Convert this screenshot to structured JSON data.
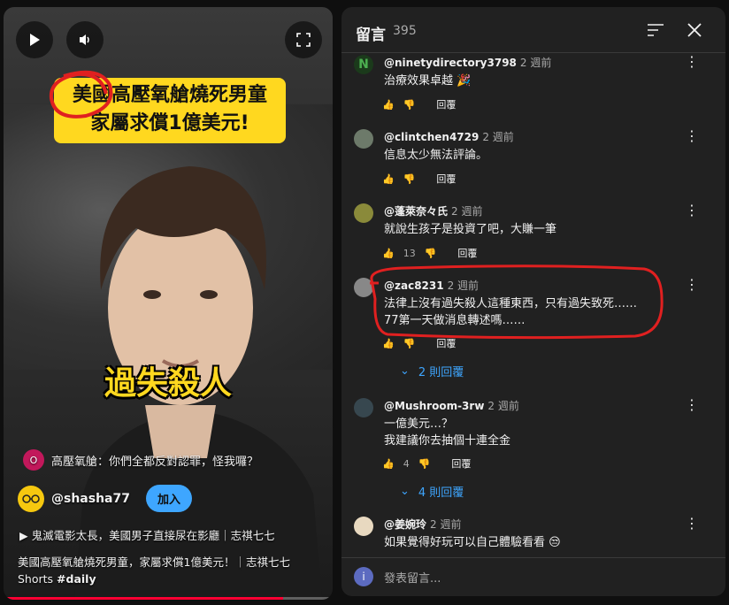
{
  "video": {
    "headline": [
      "美國高壓氧艙燒死男童",
      "家屬求償1億美元!"
    ],
    "caption": "過失殺人",
    "pinned": {
      "avatar_letter": "O",
      "text": "高壓氧艙：你們全都反對認罪，怪我囉？"
    },
    "channel": {
      "handle": "@shasha77",
      "join_label": "加入"
    },
    "related": "鬼滅電影太長，美國男子直接尿在影廳｜志祺七七",
    "title_line1": "美國高壓氧艙燒死男童，家屬求償1億美元！｜志祺七七",
    "title_line2_prefix": "Shorts ",
    "title_line2_tag": "#daily",
    "progress": 0.85
  },
  "comments_panel": {
    "title": "留言",
    "count": "395",
    "input_placeholder": "發表留言...",
    "reply_label": "回覆",
    "comments": [
      {
        "user": "@ninetydirectory3798",
        "time": "2 週前",
        "lines": [
          "治療效果卓越 🎉"
        ],
        "likes": "",
        "avatar": "N",
        "avatar_color": "#1b5e20"
      },
      {
        "user": "@clintchen4729",
        "time": "2 週前",
        "lines": [
          "信息太少無法評論。"
        ],
        "likes": "",
        "avatar": "",
        "avatar_color": "#6d7a6a"
      },
      {
        "user": "@蓬萊奈々氏",
        "time": "2 週前",
        "lines": [
          "就說生孩子是投資了吧，大賺一筆"
        ],
        "likes": "13",
        "avatar": "",
        "avatar_color": "#8a8a3a"
      },
      {
        "user": "@zac8231",
        "time": "2 週前",
        "lines": [
          "法律上沒有過失殺人這種東西，只有過失致死……",
          "77第一天做消息轉述嗎……"
        ],
        "likes": "",
        "avatar": "",
        "avatar_color": "#888888",
        "replies": "2 則回覆"
      },
      {
        "user": "@Mushroom-3rw",
        "time": "2 週前",
        "lines": [
          "一億美元…？",
          "我建議你去抽個十連全金"
        ],
        "likes": "4",
        "avatar": "",
        "avatar_color": "#37474f",
        "replies": "4 則回覆"
      },
      {
        "user": "@姜婉玲",
        "time": "2 週前",
        "lines": [
          "如果覺得好玩可以自己體驗看看 😒"
        ],
        "likes": "",
        "avatar": "",
        "avatar_color": "#e8d9c0"
      }
    ]
  },
  "colors": {
    "accent": "#3ea6ff",
    "headline_bg": "#ffd81f",
    "annotation": "#e02020",
    "progress": "#ff0033"
  }
}
